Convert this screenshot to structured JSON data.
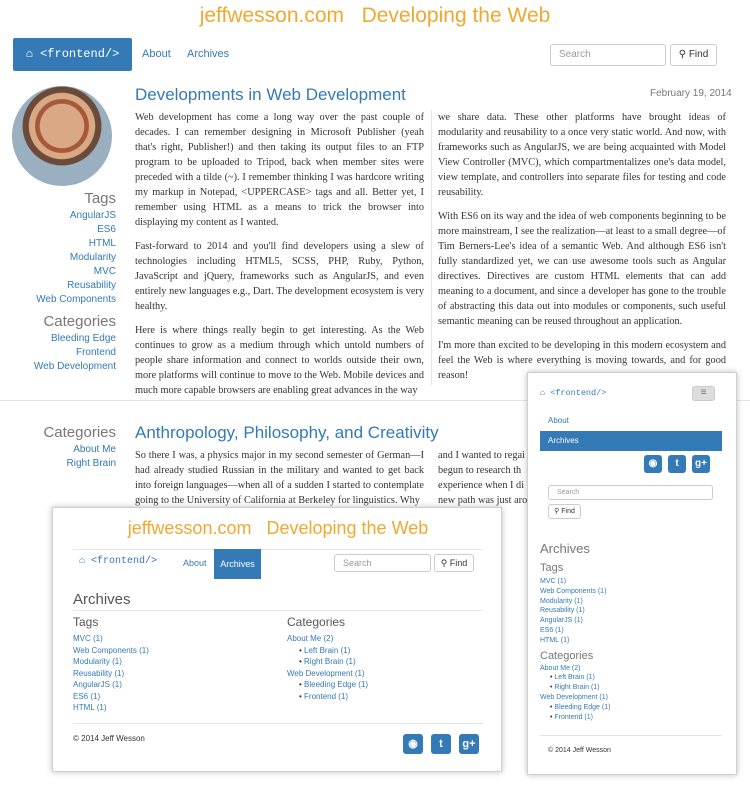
{
  "header": {
    "site": "jeffwesson.com",
    "tagline": "Developing the Web"
  },
  "nav": {
    "brand": "<frontend/>",
    "about": "About",
    "archives": "Archives",
    "search_placeholder": "Search",
    "find": "Find"
  },
  "sidebar": {
    "tags_heading": "Tags",
    "tags": [
      "AngularJS",
      "ES6",
      "HTML",
      "Modularity",
      "MVC",
      "Reusability",
      "Web Components"
    ],
    "categories_heading": "Categories",
    "categories": [
      "Bleeding Edge",
      "Frontend",
      "Web Development"
    ]
  },
  "post1": {
    "title": "Developments in Web Development",
    "date": "February 19, 2014",
    "left": [
      "Web development has come a long way over the past couple of decades. I can remember designing in Microsoft Publisher (yeah that's right, Publisher!) and then taking its output files to an FTP program to be uploaded to Tripod, back when member sites were preceded with a tilde (~). I remember thinking I was hardcore writing my markup in Notepad, <UPPERCASE> tags and all. Better yet, I remember using HTML as a means to trick the browser into displaying my content as I wanted.",
      "Fast-forward to 2014 and you'll find developers using a slew of technologies including HTML5, SCSS, PHP, Ruby, Python, JavaScript and jQuery, frameworks such as AngularJS, and even entirely new languages e.g., Dart. The development ecosystem is very healthy.",
      "Here is where things really begin to get interesting. As the Web continues to grow as a medium through which untold numbers of people share information and connect to worlds outside their own, more platforms will continue to move to the Web. Mobile devices and much more capable browsers are enabling great advances in the way"
    ],
    "right": [
      "we share data. These other platforms have brought ideas of modularity and reusability to a once very static world. And now, with frameworks such as AngularJS, we are being acquainted with Model View Controller (MVC), which compartmentalizes one's data model, view template, and controllers into separate files for testing and code reusability.",
      "With ES6 on its way and the idea of web components beginning to be more mainstream, I see the realization––at least to a small degree––of Tim Berners-Lee's idea of a semantic Web. And although ES6 isn't fully standardized yet, we can use awesome tools such as Angular directives. Directives are custom HTML elements that can add meaning to a document, and since a developer has gone to the trouble of abstracting this data out into modules or components, such useful semantic meaning can be reused throughout an application.",
      "I'm more than excited to be developing in this modern ecosystem and feel the Web is where everything is moving towards, and for good reason!"
    ]
  },
  "post2": {
    "title": "Anthropology, Philosophy, and Creativity",
    "categories_heading": "Categories",
    "categories": [
      "About Me",
      "Right Brain"
    ],
    "left": "So there I was, a physics major in my second semester of German––I had already studied Russian in the military and wanted to get back into foreign languages––when all of a sudden I started to contemplate going to the University of California at Berkeley for linguistics. Why",
    "right": [
      "and I wanted to regai",
      "begun to research th",
      "experience when I di",
      "new path was just aro"
    ]
  },
  "archives": {
    "heading": "Archives",
    "tags_heading": "Tags",
    "tags": [
      "MVC (1)",
      "Web Components (1)",
      "Modularity (1)",
      "Reusability (1)",
      "AngularJS (1)",
      "ES6 (1)",
      "HTML (1)"
    ],
    "categories_heading": "Categories",
    "categories": [
      {
        "label": "About Me (2)",
        "children": [
          "Left Brain (1)",
          "Right Brain (1)"
        ]
      },
      {
        "label": "Web Development (1)",
        "children": [
          "Bleeding Edge (1)",
          "Frontend (1)"
        ]
      }
    ],
    "footer": "© 2014 Jeff Wesson"
  },
  "mobile": {
    "brand": "<frontend/>",
    "about": "About",
    "archives": "Archives",
    "search_placeholder": "Search",
    "find": "Find",
    "heading": "Archives",
    "tags_heading": "Tags",
    "tags": [
      "MVC (1)",
      "Web Components (1)",
      "Modularity (1)",
      "Reusability (1)",
      "AngularJS (1)",
      "ES6 (1)",
      "HTML (1)"
    ],
    "categories_heading": "Categories",
    "cat_lines": [
      "About Me (2)",
      "Left Brain (1)",
      "Right Brain (1)",
      "Web Development (1)",
      "Bleeding Edge (1)",
      "Frontend (1)"
    ],
    "footer": "© 2014 Jeff Wesson"
  },
  "colors": {
    "accent": "#337ab7",
    "site_title": "#f0a830"
  },
  "icons": [
    "home-icon",
    "search-icon",
    "github-icon",
    "twitter-icon",
    "googleplus-icon",
    "menu-icon"
  ]
}
